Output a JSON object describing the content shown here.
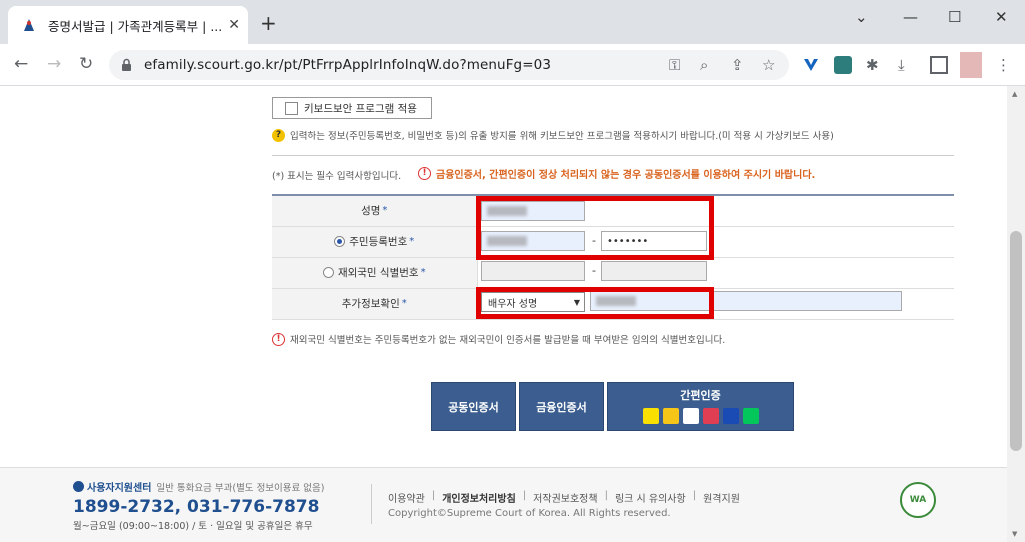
{
  "browser": {
    "tab_title": "증명서발급 | 가족관계등록부 | ...",
    "new_tab": "+",
    "url": "efamily.scourt.go.kr/pt/PtFrrpApplrInfoInqW.do?menuFg=03",
    "window_controls": {
      "minimize": "—",
      "maximize": "☐",
      "close": "✕",
      "expand": "⌄"
    }
  },
  "form": {
    "keyboard_security_label": "키보드보안 프로그램 적용",
    "keyboard_notice": "입력하는 정보(주민등록번호, 비밀번호 등)의 유출 방지를 위해 키보드보안 프로그램을 적용하시기 바랍니다.(미 적용 시 가상키보드 사용)",
    "required_note": "(*) 표시는 필수 입력사항입니다.",
    "cert_alert": "금융인증서, 간편인증이 정상 처리되지 않는 경우 공동인증서를 이용하여 주시기 바랍니다.",
    "rows": {
      "name_label": "성명",
      "rrn_label": "주민등록번호",
      "rrn_back_value": "•••••••",
      "foreign_label": "재외국민 식별번호",
      "extra_label": "추가정보확인",
      "extra_select": "배우자 성명"
    },
    "foreign_note": "재외국민 식별번호는 주민등록번호가 없는 재외국민이 인증서를 발급받을 때 부여받은 임의의 식별번호입니다.",
    "star": "*",
    "dash": "-"
  },
  "buttons": {
    "joint_cert": "공동인증서",
    "finance_cert": "금융인증서",
    "simple_auth": "간편인증"
  },
  "footer": {
    "support_center": "사용자지원센터",
    "support_sub": "일반 통화요금 부과(별도 정보이용료 없음)",
    "phone": "1899-2732, 031-776-7878",
    "hours": "월~금요일 (09:00~18:00) / 토 · 일요일 및 공휴일은 휴무",
    "links": [
      "이용약관",
      "개인정보처리방침",
      "저작권보호정책",
      "링크 시 유의사항",
      "원격지원"
    ],
    "copyright": "Copyright©Supreme Court of Korea. All Rights reserved.",
    "wa_mark": "WA"
  },
  "colors": {
    "accent": "#3b5d8f",
    "alert": "#d9631e",
    "highlight": "#e10000"
  }
}
